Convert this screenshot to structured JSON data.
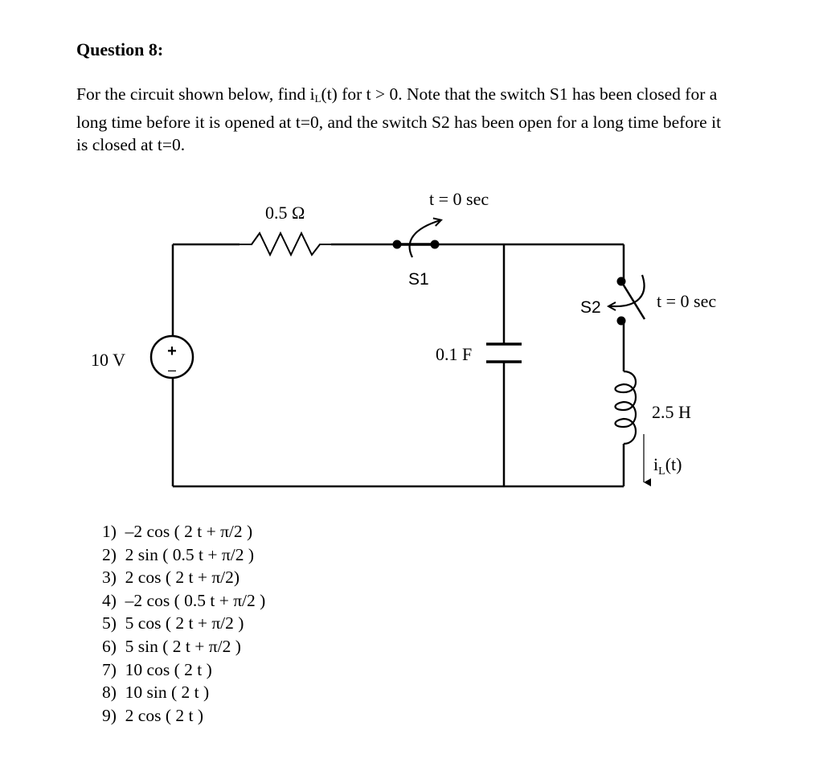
{
  "question": {
    "title": "Question 8:",
    "text_parts": {
      "before_sub": "For the circuit shown below, find i",
      "sub": "L",
      "after_sub": "(t) for t > 0. Note that the switch S1 has been closed for a long time before it is opened at t=0, and the switch S2 has been open for a long time before it is closed at t=0."
    }
  },
  "circuit": {
    "source_label": "10 V",
    "source_plus": "+",
    "source_minus": "–",
    "resistor_label": "0.5 Ω",
    "switch1_label": "S1",
    "switch1_time": "t = 0 sec",
    "capacitor_label": "0.1 F",
    "switch2_label": "S2",
    "switch2_time": "t = 0 sec",
    "inductor_label": "2.5 H",
    "current_label_main": "i",
    "current_label_sub": "L",
    "current_label_tail": "(t)"
  },
  "answers": [
    "1)  –2 cos ( 2 t + π/2 )",
    "2)  2 sin ( 0.5 t + π/2 )",
    "3)  2 cos ( 2 t + π/2)",
    "4)  –2 cos ( 0.5 t + π/2 )",
    "5)  5 cos ( 2 t + π/2 )",
    "6)  5 sin ( 2 t + π/2 )",
    "7)  10 cos ( 2 t )",
    "8)  10 sin ( 2 t )",
    "9)  2 cos ( 2 t )"
  ]
}
